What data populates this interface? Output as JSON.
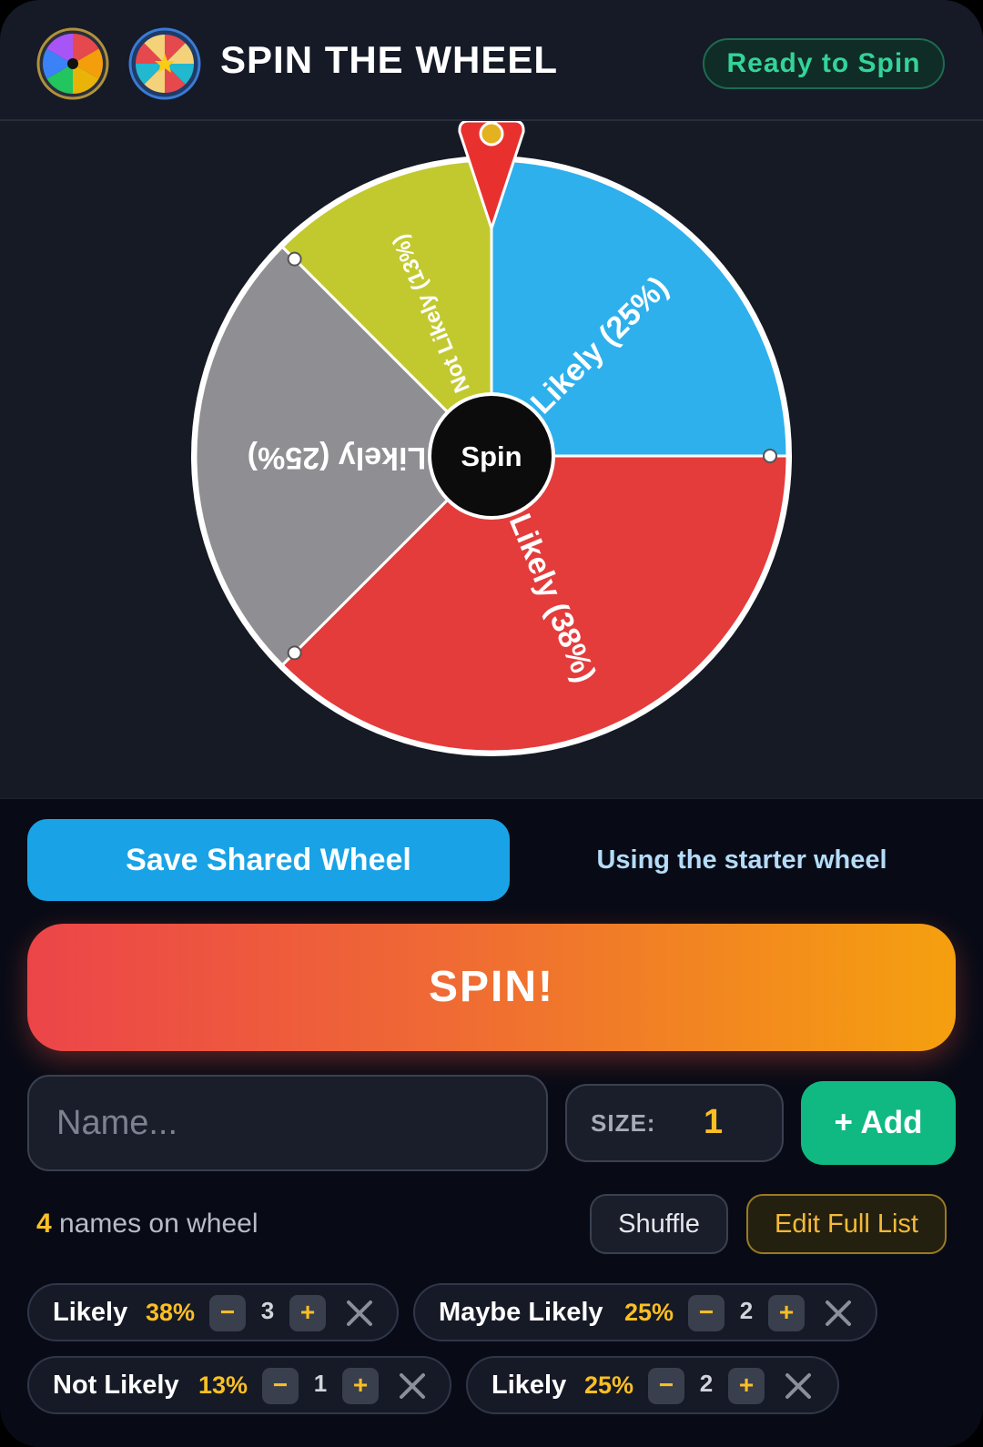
{
  "header": {
    "title": "SPIN THE WHEEL",
    "status": "Ready to Spin"
  },
  "wheel": {
    "hub_label": "Spin",
    "segments": [
      {
        "label": "Likely (25%)",
        "color": "#2eb0ec",
        "share": 0.25
      },
      {
        "label": "Likely (38%)",
        "color": "#e43b3b",
        "share": 0.375
      },
      {
        "label": "Likely (25%)",
        "color": "#8e8e93",
        "share": 0.25
      },
      {
        "label": "Not Likely (13%)",
        "color": "#c2c92f",
        "share": 0.125
      }
    ],
    "pointer_color": "#e8312f",
    "pointer_dot_color": "#e4b11f"
  },
  "actions": {
    "save_label": "Save Shared Wheel",
    "starter_note": "Using the starter wheel",
    "spin_label": "SPIN!"
  },
  "add_form": {
    "name_placeholder": "Name...",
    "size_label": "SIZE:",
    "size_value": "1",
    "add_label": "+ Add"
  },
  "list": {
    "count": "4",
    "count_suffix": "names on wheel",
    "shuffle_label": "Shuffle",
    "edit_label": "Edit Full List",
    "entries": [
      {
        "name": "Likely",
        "percent": "38%",
        "weight": "3",
        "minus": "−",
        "plus": "+"
      },
      {
        "name": "Maybe Likely",
        "percent": "25%",
        "weight": "2",
        "minus": "−",
        "plus": "+"
      },
      {
        "name": "Not Likely",
        "percent": "13%",
        "weight": "1",
        "minus": "−",
        "plus": "+"
      },
      {
        "name": "Likely",
        "percent": "25%",
        "weight": "2",
        "minus": "−",
        "plus": "+"
      }
    ]
  },
  "colors": {
    "accent_blue": "#19a3e6",
    "accent_green": "#10b981",
    "accent_gold": "#fbbf24",
    "spin_gradient_start": "#ec4549",
    "spin_gradient_end": "#f5a00f"
  }
}
